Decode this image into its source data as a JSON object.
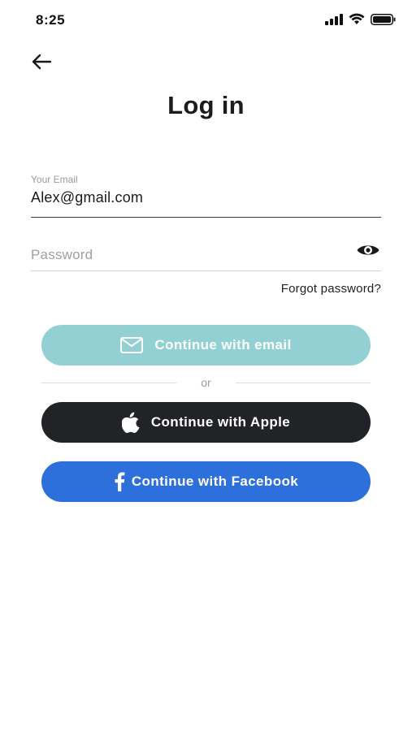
{
  "status_bar": {
    "time": "8:25",
    "icons": [
      "signal-icon",
      "wifi-icon",
      "battery-icon"
    ]
  },
  "header": {
    "back_icon": "arrow-left-icon",
    "title": "Log in"
  },
  "form": {
    "email": {
      "label": "Your Email",
      "value": "Alex@gmail.com"
    },
    "password": {
      "placeholder": "Password",
      "toggle_icon": "eye-icon"
    },
    "forgot_password": "Forgot password?"
  },
  "actions": {
    "email_button": {
      "label": "Continue with email",
      "icon": "mail-icon",
      "color": "#93d0d4"
    },
    "divider_text": "or",
    "apple_button": {
      "label": "Continue with Apple",
      "icon": "apple-icon",
      "color": "#222326"
    },
    "facebook_button": {
      "label": "Continue with Facebook",
      "icon": "facebook-icon",
      "color": "#2d6fdb"
    }
  }
}
